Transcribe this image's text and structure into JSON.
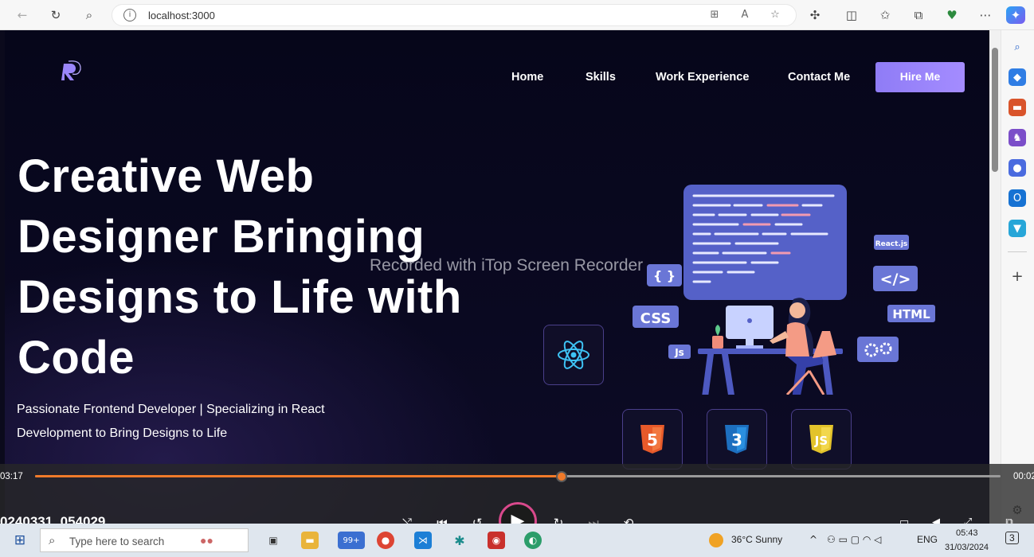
{
  "browser": {
    "url": "localhost:3000",
    "icons": [
      "back-icon",
      "refresh-icon",
      "search-icon",
      "info-icon",
      "apps-icon",
      "read-aloud-icon",
      "favorite-star-icon",
      "extensions-icon",
      "split-screen-icon",
      "favorites-icon",
      "collections-icon",
      "performance-icon",
      "more-icon",
      "copilot-icon"
    ]
  },
  "edge_sidebar": {
    "icons": [
      "search-icon",
      "shopping-icon",
      "tools-icon",
      "games-icon",
      "office-icon",
      "outlook-icon",
      "drop-icon",
      "add-icon",
      "settings-icon"
    ]
  },
  "site": {
    "logo_letter": "R",
    "nav": {
      "home": "Home",
      "skills": "Skills",
      "work": "Work Experience",
      "contact": "Contact Me",
      "hire": "Hire Me"
    },
    "hero": {
      "title_lines": [
        "Creative Web",
        "Designer Bringing",
        "Designs to Life with",
        "Code"
      ],
      "subtitle_lines": [
        "Passionate Frontend Developer | Specializing in React",
        "Development to Bring Designs to Life"
      ]
    },
    "illustration": {
      "tags": {
        "braces": "{ }",
        "css": "CSS",
        "js": "Js",
        "react": "React.js",
        "code": "</>",
        "html": "HTML"
      },
      "html5_label": "5",
      "css3_label": "3",
      "js_label": "JS"
    }
  },
  "watermark": "Recorded with iTop Screen Recorder",
  "player": {
    "time_elapsed": "03:17",
    "time_total": "00:02",
    "progress": 0.545,
    "file_name": "0240331_054029",
    "rewind_label": "10",
    "forward_label": "30"
  },
  "taskbar": {
    "search_placeholder": "Type here to search",
    "badge": "99+",
    "weather": "36°C  Sunny",
    "language": "ENG",
    "time": "05:43",
    "date": "31/03/2024",
    "notifications": "3"
  },
  "colors": {
    "accent": "#9b86fb",
    "progress": "#f07a2a",
    "play_ring": "#d9498c"
  }
}
